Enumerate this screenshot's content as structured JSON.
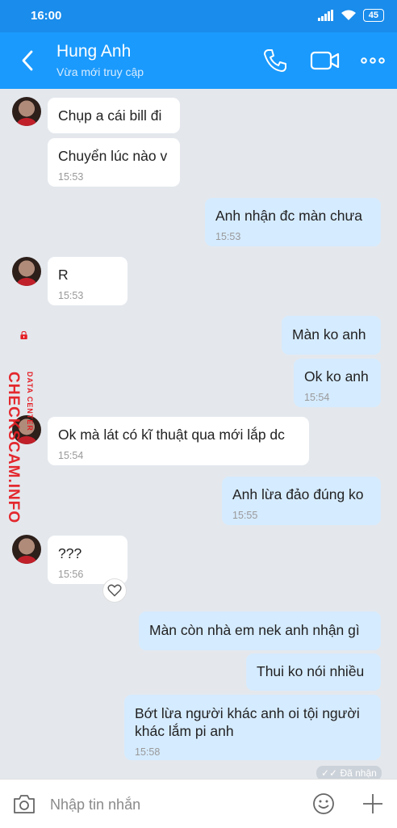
{
  "status_bar": {
    "time": "16:00",
    "battery": "45"
  },
  "header": {
    "name": "Hung Anh",
    "status": "Vừa mới truy cập"
  },
  "messages": [
    {
      "dir": "in",
      "text": "Chụp a cái bill đi",
      "time": ""
    },
    {
      "dir": "in",
      "text": "Chuyển lúc nào v",
      "time": "15:53"
    },
    {
      "dir": "out",
      "text": "Anh nhận đc màn chưa",
      "time": "15:53"
    },
    {
      "dir": "in",
      "text": "R",
      "time": "15:53"
    },
    {
      "dir": "out",
      "text": "Màn ko anh",
      "time": ""
    },
    {
      "dir": "out",
      "text": "Ok ko anh",
      "time": "15:54"
    },
    {
      "dir": "in",
      "text": "Ok mà lát có kĩ thuật qua mới lắp dc",
      "time": "15:54"
    },
    {
      "dir": "out",
      "text": "Anh lừa đảo đúng ko",
      "time": "15:55"
    },
    {
      "dir": "in",
      "text": "???",
      "time": "15:56"
    },
    {
      "dir": "out",
      "text": "Màn còn nhà em nek anh nhận gì",
      "time": ""
    },
    {
      "dir": "out",
      "text": "Thui ko nói nhiều",
      "time": ""
    },
    {
      "dir": "out",
      "text": "Bớt lừa người khác anh oi tội người khác lắm pi anh",
      "time": "15:58"
    }
  ],
  "received_label": "Đã nhận",
  "watermark": {
    "main": "CHECKSCAM.INFO",
    "sub": "DATA CENTER"
  },
  "input": {
    "placeholder": "Nhập tin nhắn"
  },
  "colors": {
    "header": "#1a9afc",
    "status_bar": "#1a8ceb",
    "bubble_in": "#ffffff",
    "bubble_out": "#d5ebff",
    "chat_bg": "#e4e8ed",
    "watermark": "#e31e24"
  }
}
